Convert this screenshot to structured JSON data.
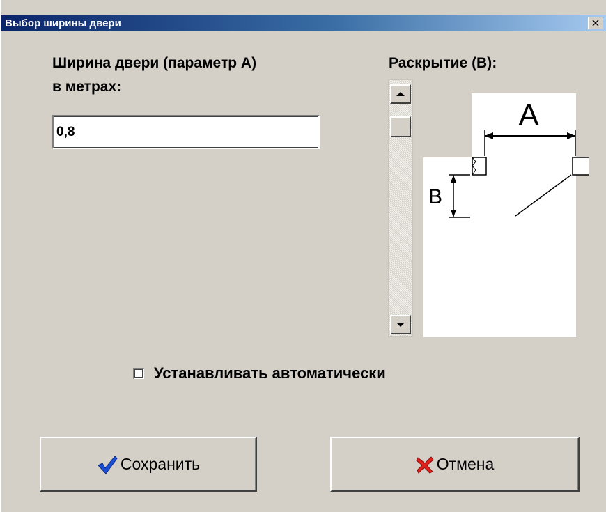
{
  "window": {
    "title": "Выбор ширины двери",
    "close_glyph": "×",
    "title_gradient": [
      "#0a246a",
      "#a6caf0"
    ],
    "face_color": "#d4d0c8"
  },
  "width_field": {
    "label_line1": "Ширина двери (параметр А)",
    "label_line2": "в метрах:",
    "value": "0,8"
  },
  "opening": {
    "label": "Раскрытие (В):",
    "scrollbar": {
      "up_icon": "arrow-up-icon",
      "down_icon": "arrow-down-icon",
      "thumb_position": 0.0
    },
    "diagram": {
      "label_a": "А",
      "label_b": "В"
    }
  },
  "auto_checkbox": {
    "label": "Устанавливать автоматически",
    "checked": false
  },
  "buttons": {
    "save": {
      "label": "Сохранить",
      "icon": "checkmark-icon",
      "icon_color": "#1a4fd6"
    },
    "cancel": {
      "label": "Отмена",
      "icon": "cross-icon",
      "icon_color": "#e0201a"
    }
  }
}
